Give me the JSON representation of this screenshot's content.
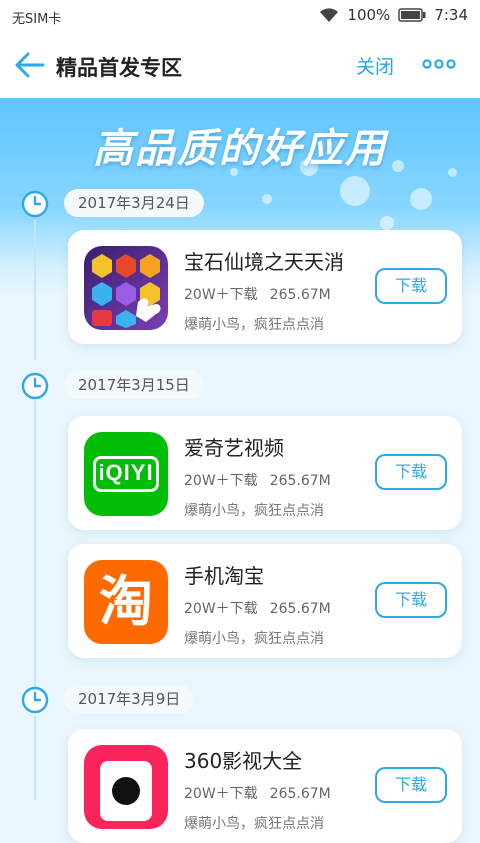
{
  "status_bar": {
    "sim": "无SIM卡",
    "battery": "100%",
    "time": "7:34"
  },
  "header": {
    "title": "精品首发专区",
    "close_label": "关闭"
  },
  "hero": {
    "slogan": "高品质的好应用"
  },
  "colors": {
    "accent": "#2ea9e8",
    "hero_top": "#5fc6ff",
    "iqiyi_green": "#00be06",
    "taobao_orange": "#ff6a00",
    "video360_pink": "#f8245a"
  },
  "groups": [
    {
      "date": "2017年3月24日",
      "apps": [
        {
          "name": "宝石仙境之天天消",
          "downloads": "20W＋下载",
          "size": "265.67M",
          "desc": "爆萌小鸟，疯狂点点消",
          "button": "下载",
          "icon": "gem-game-icon"
        }
      ]
    },
    {
      "date": "2017年3月15日",
      "apps": [
        {
          "name": "爱奇艺视频",
          "downloads": "20W＋下载",
          "size": "265.67M",
          "desc": "爆萌小鸟，疯狂点点消",
          "button": "下载",
          "icon": "iqiyi-icon",
          "icon_text": "iQIYI"
        },
        {
          "name": "手机淘宝",
          "downloads": "20W＋下载",
          "size": "265.67M",
          "desc": "爆萌小鸟，疯狂点点消",
          "button": "下载",
          "icon": "taobao-icon",
          "icon_text": "淘"
        }
      ]
    },
    {
      "date": "2017年3月9日",
      "apps": [
        {
          "name": "360影视大全",
          "downloads": "20W＋下载",
          "size": "265.67M",
          "desc": "爆萌小鸟，疯狂点点消",
          "button": "下载",
          "icon": "video360-icon"
        }
      ]
    }
  ]
}
